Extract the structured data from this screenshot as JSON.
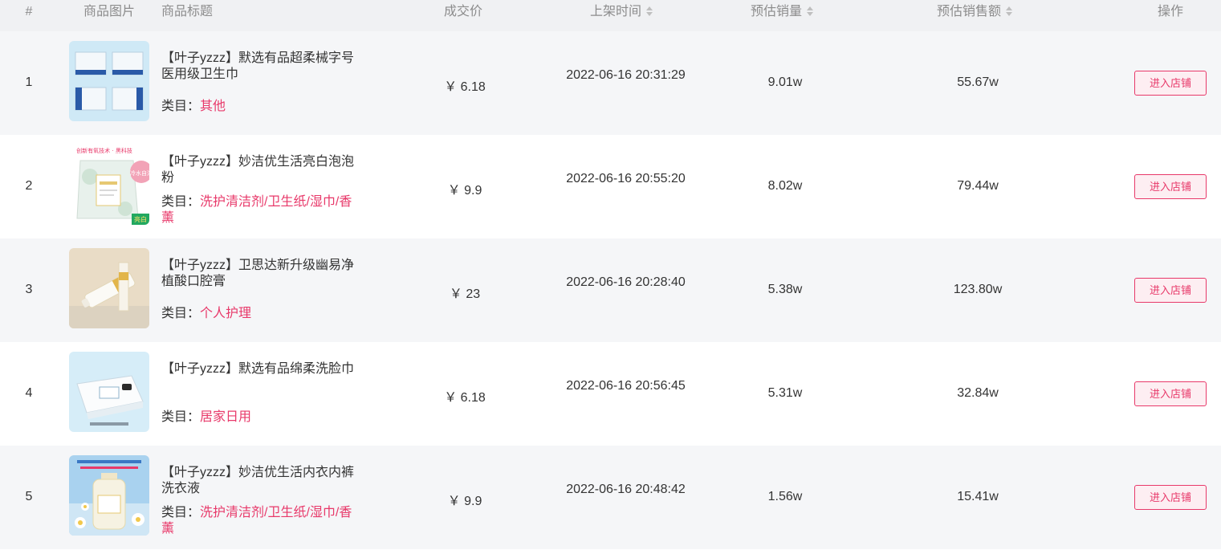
{
  "header": {
    "index": "#",
    "image": "商品图片",
    "title": "商品标题",
    "price": "成交价",
    "time": "上架时间",
    "qty": "预估销量",
    "amount": "预估销售额",
    "action": "操作"
  },
  "category_label": "类目：",
  "rows": [
    {
      "index": "1",
      "title": "【叶子yzzz】默选有品超柔械字号医用级卫生巾",
      "category": "其他",
      "price": "￥ 6.18",
      "time": "2022-06-16 20:31:29",
      "qty": "9.01w",
      "amount": "55.67w",
      "button": "进入店铺"
    },
    {
      "index": "2",
      "title": "【叶子yzzz】妙洁优生活亮白泡泡粉",
      "category": "洗护清洁剂/卫生纸/湿巾/香薰",
      "price": "￥ 9.9",
      "time": "2022-06-16 20:55:20",
      "qty": "8.02w",
      "amount": "79.44w",
      "button": "进入店铺"
    },
    {
      "index": "3",
      "title": "【叶子yzzz】卫思达新升级幽易净植酸口腔膏",
      "category": "个人护理",
      "price": "￥ 23",
      "time": "2022-06-16 20:28:40",
      "qty": "5.38w",
      "amount": "123.80w",
      "button": "进入店铺"
    },
    {
      "index": "4",
      "title": "【叶子yzzz】默选有品绵柔洗脸巾",
      "category": "居家日用",
      "price": "￥ 6.18",
      "time": "2022-06-16 20:56:45",
      "qty": "5.31w",
      "amount": "32.84w",
      "button": "进入店铺"
    },
    {
      "index": "5",
      "title": "【叶子yzzz】妙洁优生活内衣内裤洗衣液",
      "category": "洗护清洁剂/卫生纸/湿巾/香薰",
      "price": "￥ 9.9",
      "time": "2022-06-16 20:48:42",
      "qty": "1.56w",
      "amount": "15.41w",
      "button": "进入店铺"
    }
  ],
  "thumb_labels": {
    "row2_banner": "创新有氧技术 · 黑科技",
    "row2_badge": "冷水自溶",
    "row2_corner": "亮白"
  },
  "colors": {
    "accent": "#e8396a",
    "header_bg": "#f0f1f3",
    "row_alt_bg": "#f5f6f8"
  }
}
